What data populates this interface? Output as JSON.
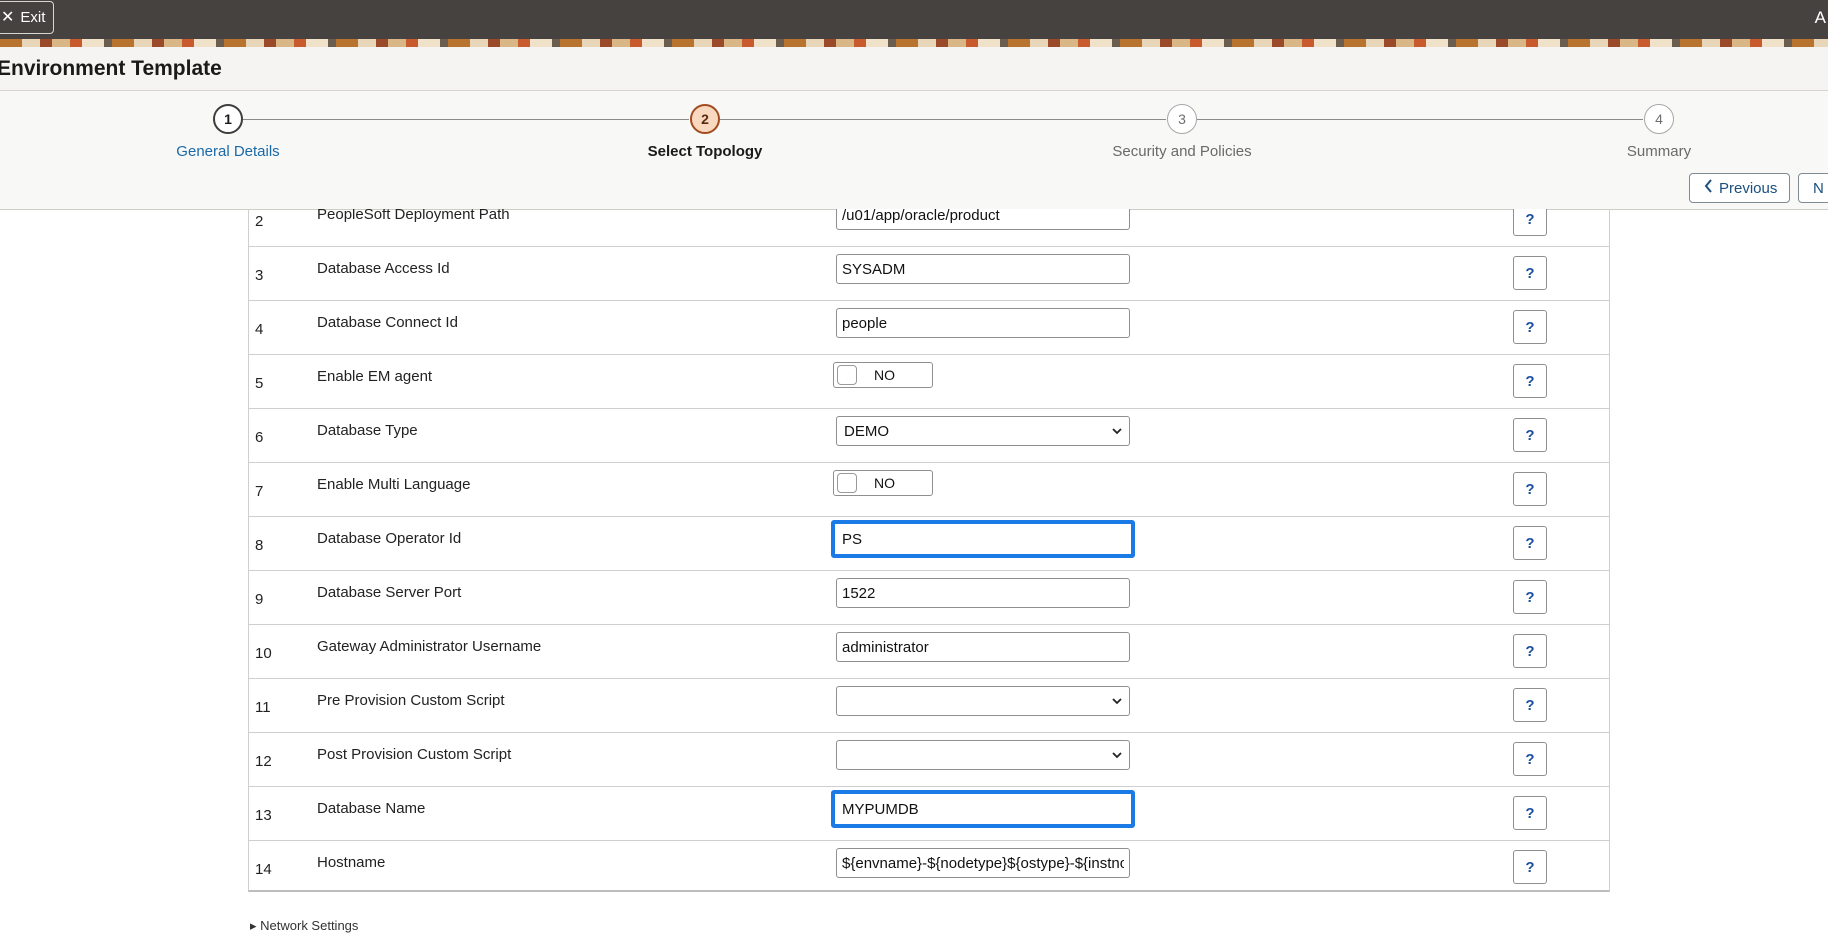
{
  "topbar": {
    "exit_label": "Exit",
    "exit_icon": "close-icon",
    "user_glyph": "A"
  },
  "header": {
    "title": "Environment Template"
  },
  "train": {
    "steps": [
      {
        "number": "1",
        "label": "General Details",
        "state": "visited"
      },
      {
        "number": "2",
        "label": "Select Topology",
        "state": "current"
      },
      {
        "number": "3",
        "label": "Security and Policies",
        "state": "upcoming"
      },
      {
        "number": "4",
        "label": "Summary",
        "state": "upcoming"
      }
    ],
    "previous_label": "Previous",
    "next_label": "N"
  },
  "rows": [
    {
      "num": "2",
      "label": "PeopleSoft Deployment Path",
      "type": "input",
      "value": "/u01/app/oracle/product",
      "help": "?"
    },
    {
      "num": "3",
      "label": "Database Access Id",
      "type": "input",
      "value": "SYSADM",
      "help": "?"
    },
    {
      "num": "4",
      "label": "Database Connect Id",
      "type": "input",
      "value": "people",
      "help": "?"
    },
    {
      "num": "5",
      "label": "Enable EM agent",
      "type": "toggle",
      "value": "NO",
      "help": "?"
    },
    {
      "num": "6",
      "label": "Database Type",
      "type": "select",
      "value": "DEMO",
      "help": "?"
    },
    {
      "num": "7",
      "label": "Enable Multi Language",
      "type": "toggle",
      "value": "NO",
      "help": "?"
    },
    {
      "num": "8",
      "label": "Database Operator Id",
      "type": "input",
      "value": "PS",
      "focused": true,
      "help": "?"
    },
    {
      "num": "9",
      "label": "Database Server Port",
      "type": "input",
      "value": "1522",
      "help": "?"
    },
    {
      "num": "10",
      "label": "Gateway Administrator Username",
      "type": "input",
      "value": "administrator",
      "help": "?"
    },
    {
      "num": "11",
      "label": "Pre Provision Custom Script",
      "type": "select",
      "value": "",
      "help": "?"
    },
    {
      "num": "12",
      "label": "Post Provision Custom Script",
      "type": "select",
      "value": "",
      "help": "?"
    },
    {
      "num": "13",
      "label": "Database Name",
      "type": "input",
      "value": "MYPUMDB",
      "focused": true,
      "help": "?"
    },
    {
      "num": "14",
      "label": "Hostname",
      "type": "input",
      "value": "${envname}-${nodetype}${ostype}-${instno}",
      "help": "?"
    }
  ],
  "footer": {
    "fragment": "▸ Network Settings"
  }
}
